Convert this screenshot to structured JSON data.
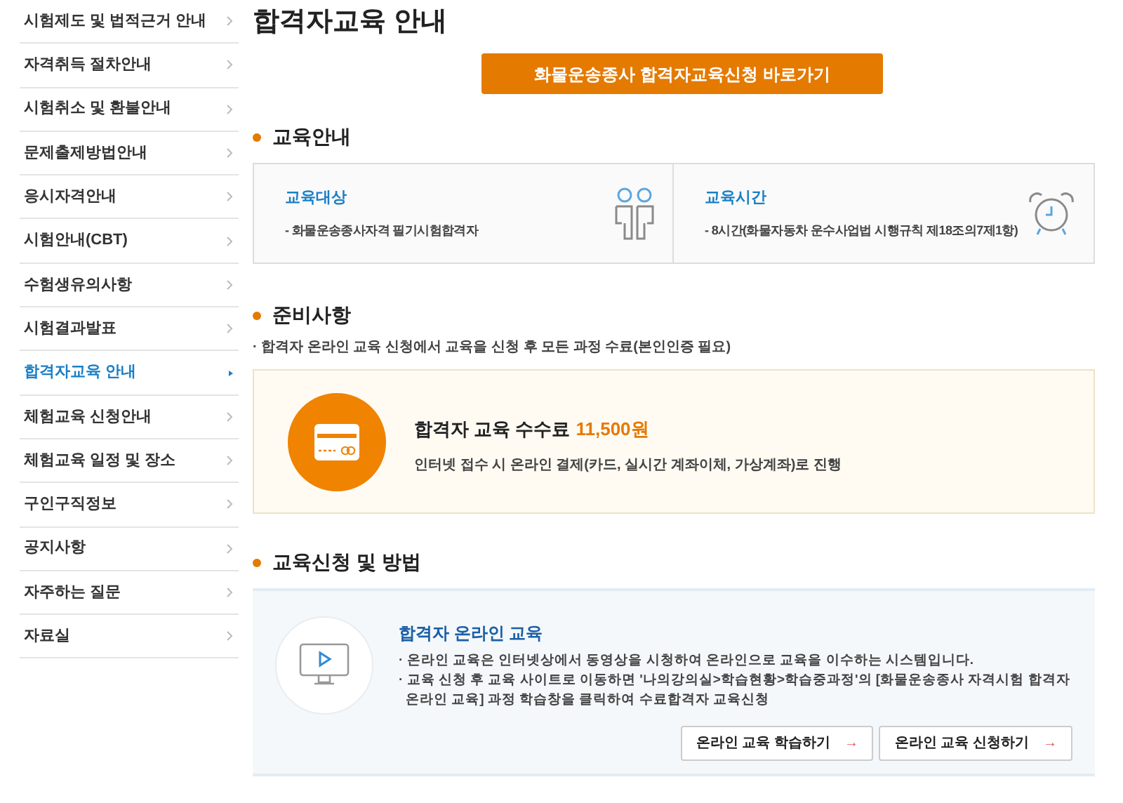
{
  "sidebar": {
    "items": [
      {
        "label": "시험제도 및 법적근거 안내",
        "selected": false
      },
      {
        "label": "자격취득 절차안내",
        "selected": false
      },
      {
        "label": "시험취소 및 환불안내",
        "selected": false
      },
      {
        "label": "문제출제방법안내",
        "selected": false
      },
      {
        "label": "응시자격안내",
        "selected": false
      },
      {
        "label": "시험안내(CBT)",
        "selected": false
      },
      {
        "label": "수험생유의사항",
        "selected": false
      },
      {
        "label": "시험결과발표",
        "selected": false
      },
      {
        "label": "합격자교육 안내",
        "selected": true
      },
      {
        "label": "체험교육 신청안내",
        "selected": false
      },
      {
        "label": "체험교육 일정 및 장소",
        "selected": false
      },
      {
        "label": "구인구직정보",
        "selected": false
      },
      {
        "label": "공지사항",
        "selected": false
      },
      {
        "label": "자주하는 질문",
        "selected": false
      },
      {
        "label": "자료실",
        "selected": false
      }
    ]
  },
  "page_title": "합격자교육 안내",
  "apply_button": "화물운송종사 합격자교육신청 바로가기",
  "education_info": {
    "heading": "교육안내",
    "cards": [
      {
        "kind": "people",
        "title": "교육대상",
        "text": "- 화물운송종사자격 필기시험합격자"
      },
      {
        "kind": "clock",
        "title": "교육시간",
        "text": "- 8시간(화물자동차 운수사업법 시행규칙 제18조의7제1항)"
      }
    ]
  },
  "preparation": {
    "heading": "준비사항",
    "note": "· 합격자 온라인 교육 신청에서 교육을 신청 후 모든 과정 수료(본인인증 필요)",
    "fee_label": "합격자 교육 수수료",
    "fee_amount": "11,500원",
    "payment_text": "인터넷 접수 시 온라인 결제(카드, 실시간 계좌이체, 가상계좌)로 진행"
  },
  "application": {
    "heading": "교육신청 및 방법",
    "title": "합격자 온라인 교육",
    "lines": [
      "· 온라인 교육은 인터넷상에서 동영상을 시청하여 온라인으로 교육을 이수하는 시스템입니다.",
      "· 교육 신청 후 교육 사이트로 이동하면 '나의강의실>학습현황>학습중과정'의 [화물운송종사 자격시험 합격자 온라인 교육] 과정 학습창을 클릭하여 수료합격자 교육신청"
    ],
    "buttons": [
      {
        "label": "온라인 교육 학습하기",
        "arrow": "→"
      },
      {
        "label": "온라인 교육 신청하기",
        "arrow": "→"
      }
    ]
  }
}
